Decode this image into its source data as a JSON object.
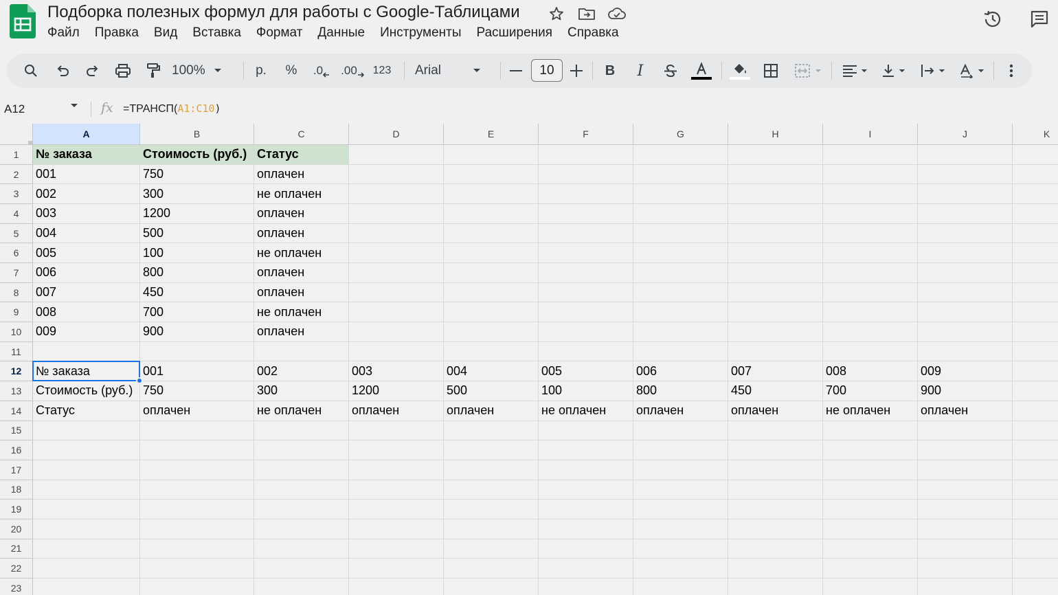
{
  "app": {
    "title": "Подборка полезных формул для работы с Google-Таблицами",
    "logo_icon": "google-sheets-logo",
    "accent": "#1a73e8",
    "logo_color": "#0f9d58"
  },
  "menu": [
    "Файл",
    "Правка",
    "Вид",
    "Вставка",
    "Формат",
    "Данные",
    "Инструменты",
    "Расширения",
    "Справка"
  ],
  "toolbar": {
    "zoom": "100%",
    "currency": "р.",
    "percent": "%",
    "decimal_decrease": ".0",
    "decimal_increase": ".00",
    "number_format": "123",
    "font": "Arial",
    "font_size": "10"
  },
  "formula_bar": {
    "name_box": "A12",
    "prefix": "=ТРАНСП(",
    "range": "A1:C10",
    "suffix": ")"
  },
  "columns": [
    "A",
    "B",
    "C",
    "D",
    "E",
    "F",
    "G",
    "H",
    "I",
    "J",
    "K"
  ],
  "rows": [
    "1",
    "2",
    "3",
    "4",
    "5",
    "6",
    "7",
    "8",
    "9",
    "10",
    "11",
    "12",
    "13",
    "14",
    "15",
    "16",
    "17",
    "18",
    "19",
    "20",
    "21",
    "22",
    "23"
  ],
  "active_cell": {
    "col": "A",
    "row": "12"
  },
  "header_fill": "#cfe2cf",
  "cells": {
    "A1": "№ заказа",
    "B1": "Стоимость (руб.)",
    "C1": "Статус",
    "A2": "001",
    "B2": "750",
    "C2": "оплачен",
    "A3": "002",
    "B3": "300",
    "C3": "не оплачен",
    "A4": "003",
    "B4": "1200",
    "C4": "оплачен",
    "A5": "004",
    "B5": "500",
    "C5": "оплачен",
    "A6": "005",
    "B6": "100",
    "C6": "не оплачен",
    "A7": "006",
    "B7": "800",
    "C7": "оплачен",
    "A8": "007",
    "B8": "450",
    "C8": "оплачен",
    "A9": "008",
    "B9": "700",
    "C9": "не оплачен",
    "A10": "009",
    "B10": "900",
    "C10": "оплачен",
    "A12": "№ заказа",
    "B12": "001",
    "C12": "002",
    "D12": "003",
    "E12": "004",
    "F12": "005",
    "G12": "006",
    "H12": "007",
    "I12": "008",
    "J12": "009",
    "A13": "Стоимость (руб.)",
    "B13": "750",
    "C13": "300",
    "D13": "1200",
    "E13": "500",
    "F13": "100",
    "G13": "800",
    "H13": "450",
    "I13": "700",
    "J13": "900",
    "A14": "Статус",
    "B14": "оплачен",
    "C14": "не оплачен",
    "D14": "оплачен",
    "E14": "оплачен",
    "F14": "не оплачен",
    "G14": "оплачен",
    "H14": "оплачен",
    "I14": "не оплачен",
    "J14": "оплачен"
  },
  "header_cells": [
    "A1",
    "B1",
    "C1"
  ]
}
